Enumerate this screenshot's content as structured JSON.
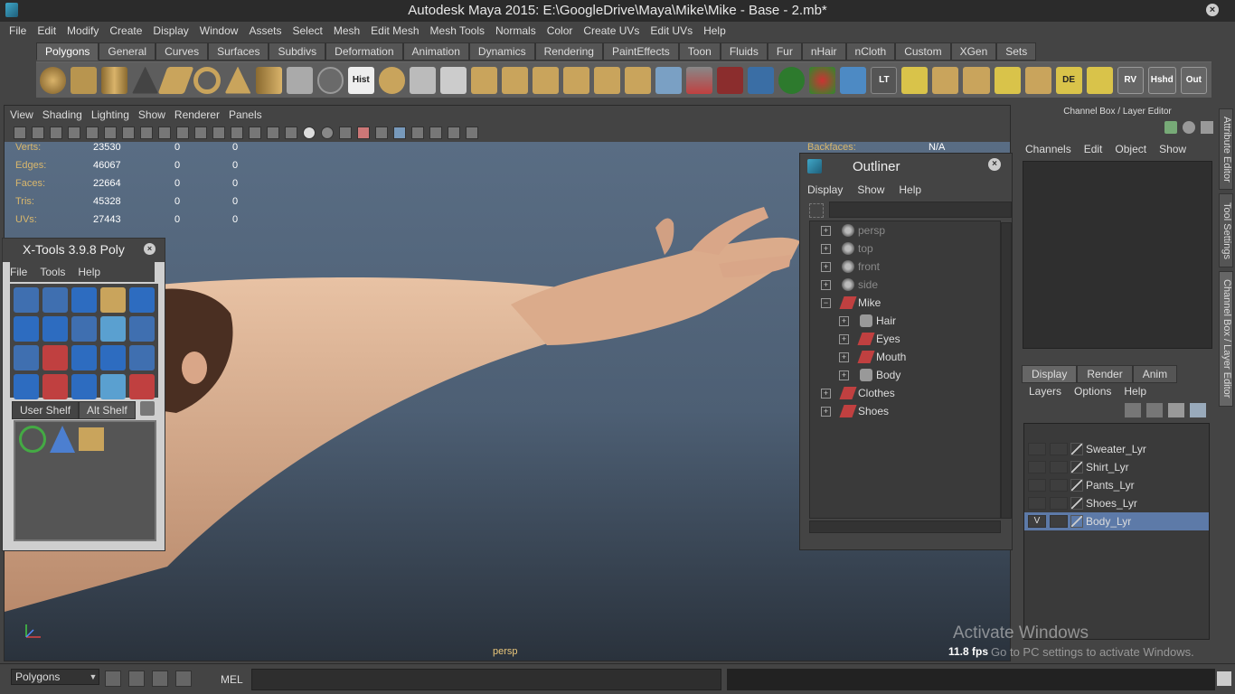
{
  "window": {
    "title": "Autodesk Maya 2015: E:\\GoogleDrive\\Maya\\Mike\\Mike - Base - 2.mb*",
    "close_icon": "close-icon"
  },
  "menubar": [
    "File",
    "Edit",
    "Modify",
    "Create",
    "Display",
    "Window",
    "Assets",
    "Select",
    "Mesh",
    "Edit Mesh",
    "Mesh Tools",
    "Normals",
    "Color",
    "Create UVs",
    "Edit UVs",
    "Help"
  ],
  "shelf": {
    "tabs": [
      "Polygons",
      "General",
      "Curves",
      "Surfaces",
      "Subdivs",
      "Deformation",
      "Animation",
      "Dynamics",
      "Rendering",
      "PaintEffects",
      "Toon",
      "Fluids",
      "Fur",
      "nHair",
      "nCloth",
      "Custom",
      "XGen",
      "Sets"
    ],
    "active_tab": "Polygons",
    "text_icons": {
      "hist": "Hist",
      "lt": "LT",
      "de": "DE",
      "rv": "RV",
      "hshd": "Hshd",
      "out": "Out"
    }
  },
  "viewport": {
    "menu": [
      "View",
      "Shading",
      "Lighting",
      "Show",
      "Renderer",
      "Panels"
    ],
    "camera_label": "persp",
    "fps": "11.8 fps",
    "backfaces_label": "Backfaces:",
    "backfaces_value": "N/A",
    "hud": [
      {
        "label": "Verts:",
        "v1": "23530",
        "v2": "0",
        "v3": "0"
      },
      {
        "label": "Edges:",
        "v1": "46067",
        "v2": "0",
        "v3": "0"
      },
      {
        "label": "Faces:",
        "v1": "22664",
        "v2": "0",
        "v3": "0"
      },
      {
        "label": "Tris:",
        "v1": "45328",
        "v2": "0",
        "v3": "0"
      },
      {
        "label": "UVs:",
        "v1": "27443",
        "v2": "0",
        "v3": "0"
      }
    ]
  },
  "outliner": {
    "title": "Outliner",
    "menu": [
      "Display",
      "Show",
      "Help"
    ],
    "items": [
      {
        "label": "persp",
        "type": "camera",
        "dim": true,
        "indent": 0,
        "toggle": "+"
      },
      {
        "label": "top",
        "type": "camera",
        "dim": true,
        "indent": 0,
        "toggle": "+"
      },
      {
        "label": "front",
        "type": "camera",
        "dim": true,
        "indent": 0,
        "toggle": "+"
      },
      {
        "label": "side",
        "type": "camera",
        "dim": true,
        "indent": 0,
        "toggle": "+"
      },
      {
        "label": "Mike",
        "type": "mesh",
        "dim": false,
        "indent": 0,
        "toggle": "−"
      },
      {
        "label": "Hair",
        "type": "group",
        "dim": false,
        "indent": 1,
        "toggle": "+"
      },
      {
        "label": "Eyes",
        "type": "mesh",
        "dim": false,
        "indent": 1,
        "toggle": "+"
      },
      {
        "label": "Mouth",
        "type": "mesh",
        "dim": false,
        "indent": 1,
        "toggle": "+"
      },
      {
        "label": "Body",
        "type": "group",
        "dim": false,
        "indent": 1,
        "toggle": "+"
      },
      {
        "label": "Clothes",
        "type": "mesh",
        "dim": false,
        "indent": 0,
        "toggle": "+"
      },
      {
        "label": "Shoes",
        "type": "mesh",
        "dim": false,
        "indent": 0,
        "toggle": "+"
      }
    ]
  },
  "channel_box": {
    "title": "Channel Box / Layer Editor",
    "menu": [
      "Channels",
      "Edit",
      "Object",
      "Show"
    ],
    "layer_tabs": [
      "Display",
      "Render",
      "Anim"
    ],
    "active_layer_tab": "Display",
    "layer_menu": [
      "Layers",
      "Options",
      "Help"
    ],
    "layers": [
      {
        "name": "Sweater_Lyr",
        "visible": "",
        "selected": false
      },
      {
        "name": "Shirt_Lyr",
        "visible": "",
        "selected": false
      },
      {
        "name": "Pants_Lyr",
        "visible": "",
        "selected": false
      },
      {
        "name": "Shoes_Lyr",
        "visible": "",
        "selected": false
      },
      {
        "name": "Body_Lyr",
        "visible": "V",
        "selected": true
      }
    ]
  },
  "side_tabs": [
    "Attribute Editor",
    "Tool Settings",
    "Channel Box / Layer Editor"
  ],
  "xtools": {
    "title": "X-Tools 3.9.8 Poly",
    "menu": [
      "File",
      "Tools",
      "Help"
    ],
    "shelf_tabs": [
      "User Shelf",
      "Alt Shelf"
    ],
    "active_shelf_tab": "User Shelf"
  },
  "bottom": {
    "mode": "Polygons",
    "mel_label": "MEL"
  },
  "watermark": {
    "line1": "Activate Windows",
    "line2": "Go to PC settings to activate Windows."
  },
  "colors": {
    "accent_select": "#5d7aa8",
    "hud_label": "#d9b76c",
    "skin": "#e0b79a"
  }
}
